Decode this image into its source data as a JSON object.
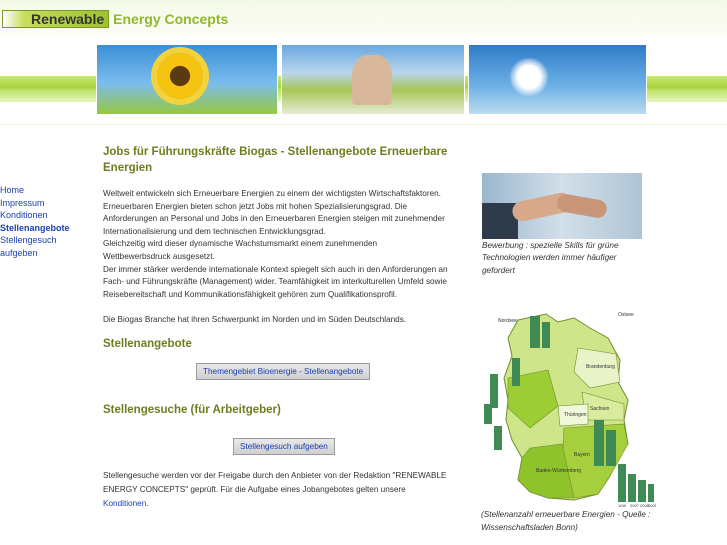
{
  "header": {
    "logo_primary": "Renewable",
    "logo_secondary": "Energy Concepts"
  },
  "banner_images": [
    "sunflower-image",
    "children-meadow-image",
    "dandelion-image"
  ],
  "sidebar": {
    "items": [
      {
        "label": "Home",
        "active": false
      },
      {
        "label": "Impressum",
        "active": false
      },
      {
        "label": "Konditionen",
        "active": false
      },
      {
        "label": "Stellenangebote",
        "active": true
      },
      {
        "label": "Stellengesuch aufgeben",
        "active": false
      }
    ]
  },
  "main": {
    "title": "Jobs für Führungskräfte Biogas - Stellenangebote Erneuerbare Energien",
    "intro_lines": [
      "Weltweit entwickeln sich Erneuerbare Energien zu einem der wichtigsten Wirtschaftsfaktoren.",
      "Erneuerbaren Energien bieten schon jetzt Jobs mit hohen Spezialisierungsgrad. Die",
      "Anforderungen an Personal und Jobs in den Erneuerbaren Energien steigen mit zunehmender",
      "Internationalisierung und dem technischen Entwicklungsgrad.",
      "Gleichzeitig wird dieser dynamische Wachstumsmarkt einem zunehmenden",
      "Wettbewerbsdruck ausgesetzt.",
      "Der immer stärker werdende internationale Kontext spiegelt sich auch in den Anforderungen an",
      "Fach- und Führungskräfte (Management) wider. Teamfähigkeit im interkulturellen Umfeld sowie",
      "Reisebereitschaft und Kommunikationsfähigkeit gehören zum Qualifikationsprofil."
    ],
    "biogas_note": "Die Biogas Branche hat ihren Schwerpunkt im Norden und im Süden Deutschlands.",
    "offers_heading": "Stellenangebote",
    "offers_button": "Themengebiet Bioenergie - Stellenangebote",
    "search_heading": "Stellengesuche (für Arbeitgeber)",
    "search_button": "Stellengesuch aufgeben",
    "footer_line1": "Stellengesuche werden vor der Freigabe durch den Anbieter von der Redaktion \"RENEWABLE",
    "footer_line2": "ENERGY CONCEPTS\" geprüft. Für die Aufgabe eines Jobangebotes gelten unsere",
    "footer_link": "Konditionen",
    "footer_end": "."
  },
  "right": {
    "photo_caption": "Bewerbung : spezielle Skills für grüne Technologien werden immer häufiger gefordert",
    "map_caption": "(Stellenanzahl erneuerbare Energien - Quelle : Wissenschaftsladen Bonn)",
    "map_labels": [
      "Nordsee",
      "Ostsee",
      "Brandenburg",
      "Sachsen",
      "Thüringen",
      "Bayern",
      "Baden-Württemberg"
    ],
    "map_years": [
      "1/08",
      "2007",
      "2008",
      "2009"
    ]
  },
  "colors": {
    "heading_green": "#6b7f1e",
    "link_blue": "#1a3fb0",
    "band_green": "#a8d43c"
  }
}
